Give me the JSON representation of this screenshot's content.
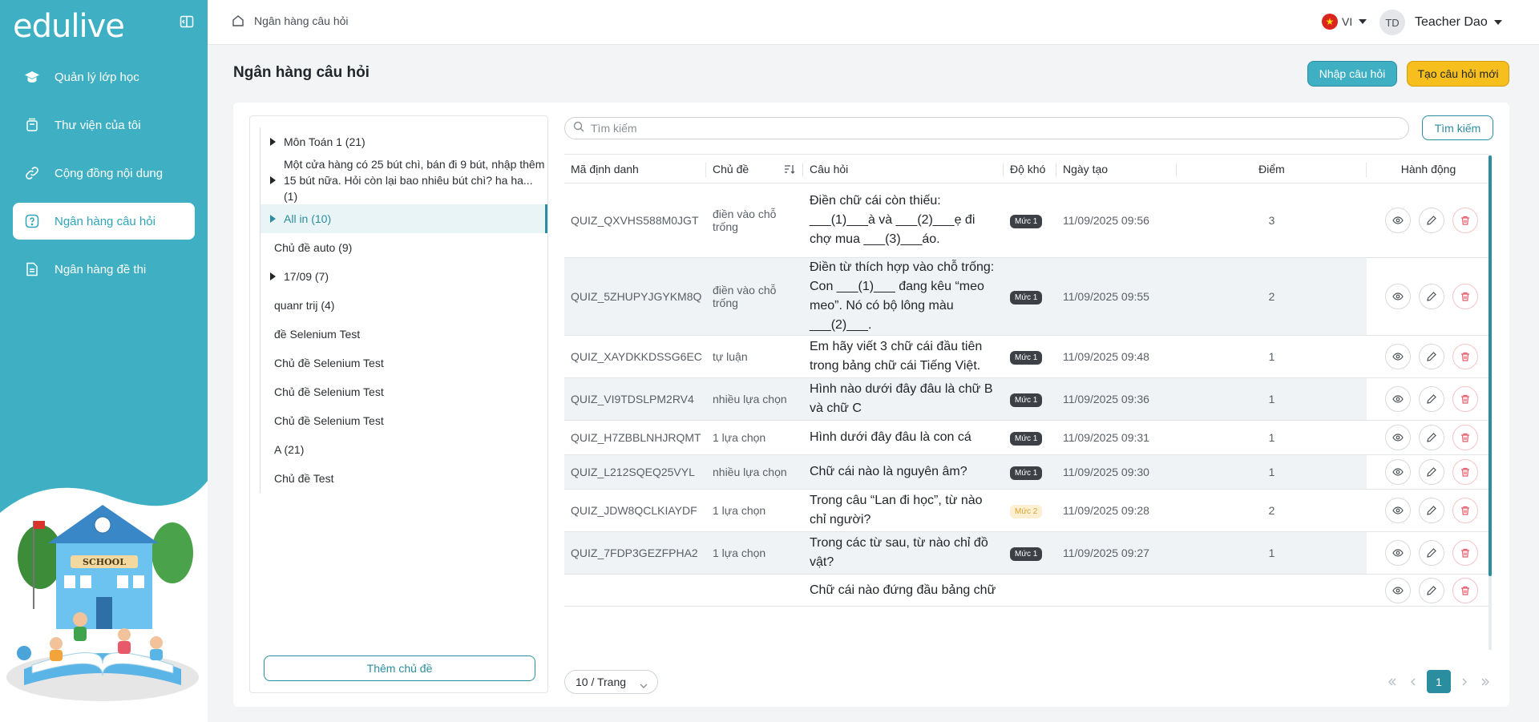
{
  "brand": {
    "logo_text": "edulive"
  },
  "sidebar": {
    "items": [
      {
        "label": "Quản lý lớp học",
        "icon": "graduation-cap-icon"
      },
      {
        "label": "Thư viện của tôi",
        "icon": "library-icon"
      },
      {
        "label": "Cộng đồng nội dung",
        "icon": "link-icon"
      },
      {
        "label": "Ngân hàng câu hỏi",
        "icon": "question-icon",
        "active": true
      },
      {
        "label": "Ngân hàng đề thi",
        "icon": "document-icon"
      }
    ]
  },
  "topbar": {
    "breadcrumb": "Ngân hàng câu hỏi",
    "language": "VI",
    "user_initials": "TD",
    "user_name": "Teacher Dao"
  },
  "page": {
    "title": "Ngân hàng câu hỏi",
    "import_button": "Nhập câu hỏi",
    "create_button": "Tạo câu hỏi mới"
  },
  "tree": {
    "items": [
      {
        "label": "Môn Toán 1 (21)",
        "expandable": true
      },
      {
        "label": "Một cửa hàng có 25 bút chì, bán đi 9 bút, nhập thêm 15 bút nữa. Hỏi còn lại bao nhiêu bút chì? ha ha... (1)",
        "expandable": true
      },
      {
        "label": "All in (10)",
        "expandable": true,
        "active": true
      },
      {
        "label": "Chủ đề auto (9)",
        "expandable": false
      },
      {
        "label": "17/09 (7)",
        "expandable": true
      },
      {
        "label": "quanr trij (4)",
        "expandable": false
      },
      {
        "label": "đề Selenium Test",
        "expandable": false
      },
      {
        "label": "Chủ đề Selenium Test",
        "expandable": false
      },
      {
        "label": "Chủ đề Selenium Test",
        "expandable": false
      },
      {
        "label": "Chủ đề Selenium Test",
        "expandable": false
      },
      {
        "label": "A (21)",
        "expandable": false
      },
      {
        "label": "Chủ đề Test",
        "expandable": false
      }
    ],
    "add_button": "Thêm chủ đề"
  },
  "search": {
    "placeholder": "Tìm kiếm",
    "button": "Tìm kiếm"
  },
  "table": {
    "columns": {
      "id": "Mã định danh",
      "topic": "Chủ đề",
      "question": "Câu hỏi",
      "difficulty": "Độ khó",
      "created": "Ngày tạo",
      "score": "Điểm",
      "actions": "Hành động"
    },
    "rows": [
      {
        "id": "QUIZ_QXVHS588M0JGT",
        "topic": "điền vào chỗ trống",
        "question": "Điền chữ cái còn thiếu: ___(1)___à và ___(2)___ẹ đi chợ mua ___(3)___áo.",
        "difficulty": "Mức 1",
        "created": "11/09/2025 09:56",
        "score": "3"
      },
      {
        "id": "QUIZ_5ZHUPYJGYKM8Q",
        "topic": "điền vào chỗ trống",
        "question": "Điền từ thích hợp vào chỗ trống: Con ___(1)___ đang kêu “meo meo”. Nó có bộ lông màu ___(2)___.",
        "difficulty": "Mức 1",
        "created": "11/09/2025 09:55",
        "score": "2"
      },
      {
        "id": "QUIZ_XAYDKKDSSG6EC",
        "topic": "tự luận",
        "question": "Em hãy viết 3 chữ cái đầu tiên trong bảng chữ cái Tiếng Việt.",
        "difficulty": "Mức 1",
        "created": "11/09/2025 09:48",
        "score": "1"
      },
      {
        "id": "QUIZ_VI9TDSLPM2RV4",
        "topic": "nhiều lựa chọn",
        "question": "Hình nào dưới đây đâu là chữ B và chữ C",
        "difficulty": "Mức 1",
        "created": "11/09/2025 09:36",
        "score": "1"
      },
      {
        "id": "QUIZ_H7ZBBLNHJRQMT",
        "topic": "1 lựa chọn",
        "question": "Hình dưới đây đâu là con cá",
        "difficulty": "Mức 1",
        "created": "11/09/2025 09:31",
        "score": "1"
      },
      {
        "id": "QUIZ_L212SQEQ25VYL",
        "topic": "nhiều lựa chọn",
        "question": "Chữ cái nào là nguyên âm?",
        "difficulty": "Mức 1",
        "created": "11/09/2025 09:30",
        "score": "1"
      },
      {
        "id": "QUIZ_JDW8QCLKIAYDF",
        "topic": "1 lựa chọn",
        "question": "Trong câu “Lan đi học”, từ nào chỉ người?",
        "difficulty": "Mức 2",
        "created": "11/09/2025 09:28",
        "score": "2"
      },
      {
        "id": "QUIZ_7FDP3GEZFPHA2",
        "topic": "1 lựa chọn",
        "question": "Trong các từ sau, từ nào chỉ đồ vật?",
        "difficulty": "Mức 1",
        "created": "11/09/2025 09:27",
        "score": "1"
      },
      {
        "id": "",
        "topic": "",
        "question": "Chữ cái nào đứng đầu bảng chữ",
        "difficulty": "",
        "created": "",
        "score": ""
      }
    ]
  },
  "pagination": {
    "page_size": "10 / Trang",
    "current_page": "1"
  },
  "colors": {
    "brand": "#3fb0c4",
    "accent_dark": "#2b8ea0",
    "create": "#f6bf1e",
    "danger": "#e85a6a"
  }
}
